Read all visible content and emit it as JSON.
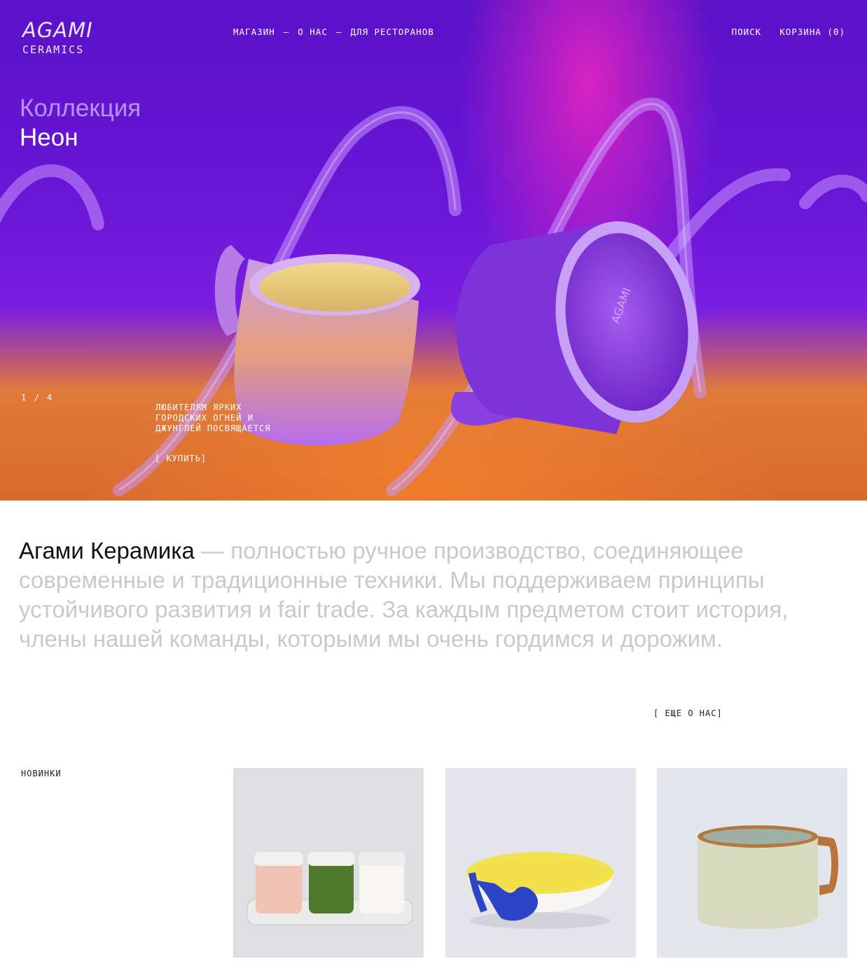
{
  "header": {
    "logo_brand": "AGAMI",
    "logo_sub": "CERAMICS",
    "nav": [
      {
        "label": "МАГАЗИН"
      },
      {
        "label": "О НАС"
      },
      {
        "label": "ДЛЯ РЕСТОРАНОВ"
      }
    ],
    "nav_separator": "—",
    "search_label": "ПОИСК",
    "cart_label": "КОРЗИНА (0)"
  },
  "hero": {
    "collection_prefix": "Коллекция",
    "collection_name": "Неон",
    "counter": "1 / 4",
    "tagline": "ЛЮБИТЕЛЯМ ЯРКИХ ГОРОДСКИХ ОГНЕЙ И ДЖУНГЛЕЙ ПОСВЯЩАЕТСЯ",
    "buy_label": "[ КУПИТЬ]",
    "colors": {
      "purple": "#6a16d6",
      "magenta": "#ff28be",
      "orange": "#d96a2e"
    }
  },
  "about": {
    "brand": "Агами Керамика",
    "text": " — полностью ручное производство, соединяющее современные и традиционные техники. Мы поддерживаем принципы устойчивого развития и fair trade. За каждым предметом стоит история, члены нашей команды, которыми мы очень гордимся и дорожим.",
    "more_label": "[ ЕЩЕ О НАС]"
  },
  "new_items": {
    "label": "НОВИНКИ",
    "products": [
      {
        "image": "three-jars-on-tray"
      },
      {
        "image": "blue-yellow-bowl"
      },
      {
        "image": "sage-mug"
      }
    ]
  }
}
